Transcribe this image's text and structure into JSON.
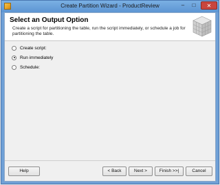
{
  "window": {
    "title": "Create Partition Wizard - ProductReview",
    "minimize_glyph": "–",
    "maximize_glyph": "□",
    "close_glyph": "✕"
  },
  "header": {
    "title": "Select an Output Option",
    "description": "Create a script for partitioning the table, run the script immediately, or schedule a job for partitioning the table."
  },
  "options": [
    {
      "label": "Create script:",
      "checked": false
    },
    {
      "label": "Run immediately",
      "checked": true
    },
    {
      "label": "Schedule:",
      "checked": false
    }
  ],
  "buttons": {
    "help": "Help",
    "back": "< Back",
    "next": "Next >",
    "finish": "Finish >>|",
    "cancel": "Cancel"
  },
  "colors": {
    "title_bar": "#6fa0d6",
    "close_button": "#c9463d",
    "dialog_background": "#f0f0f0",
    "header_background": "#ffffff"
  }
}
